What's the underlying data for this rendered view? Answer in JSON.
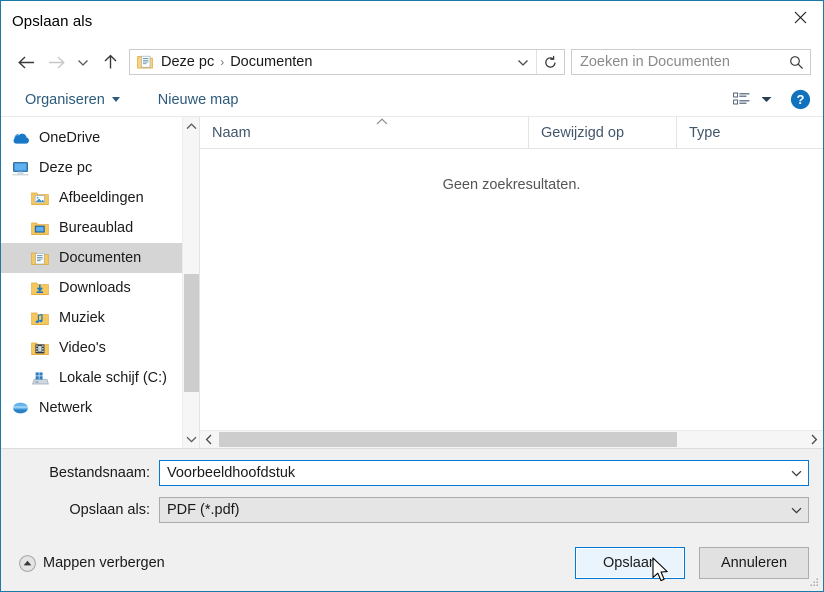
{
  "window": {
    "title": "Opslaan als",
    "close_icon": "close-icon"
  },
  "navigation": {
    "back_label": "Terug",
    "forward_label": "Vooruit",
    "recent_label": "Recente locaties",
    "up_label": "Omhoog",
    "breadcrumbs": [
      "Deze pc",
      "Documenten"
    ],
    "separator": "›",
    "refresh_label": "Vernieuwen"
  },
  "search": {
    "placeholder": "Zoeken in Documenten"
  },
  "toolbar": {
    "organize_label": "Organiseren",
    "new_folder_label": "Nieuwe map",
    "view_label": "De weergave wijzigen",
    "help_label": "Help",
    "help_glyph": "?"
  },
  "sidebar": {
    "items": [
      {
        "label": "OneDrive",
        "icon": "onedrive-cloud-icon",
        "indent": false,
        "selected": false
      },
      {
        "label": "Deze pc",
        "icon": "this-pc-icon",
        "indent": false,
        "selected": false
      },
      {
        "label": "Afbeeldingen",
        "icon": "pictures-folder-icon",
        "indent": true,
        "selected": false
      },
      {
        "label": "Bureaublad",
        "icon": "desktop-folder-icon",
        "indent": true,
        "selected": false
      },
      {
        "label": "Documenten",
        "icon": "documents-folder-icon",
        "indent": true,
        "selected": true
      },
      {
        "label": "Downloads",
        "icon": "downloads-folder-icon",
        "indent": true,
        "selected": false
      },
      {
        "label": "Muziek",
        "icon": "music-folder-icon",
        "indent": true,
        "selected": false
      },
      {
        "label": "Video's",
        "icon": "videos-folder-icon",
        "indent": true,
        "selected": false
      },
      {
        "label": "Lokale schijf (C:)",
        "icon": "local-disk-icon",
        "indent": true,
        "selected": false
      },
      {
        "label": "Netwerk",
        "icon": "network-icon",
        "indent": false,
        "selected": false
      }
    ]
  },
  "filelist": {
    "columns": [
      "Naam",
      "Gewijzigd op",
      "Type"
    ],
    "sorted_column": "Naam",
    "sort_direction": "ascending",
    "empty_message": "Geen zoekresultaten.",
    "rows": []
  },
  "form": {
    "filename_label": "Bestandsnaam:",
    "filename_value": "Voorbeeldhoofdstuk",
    "filetype_label": "Opslaan als:",
    "filetype_value": "PDF (*.pdf)"
  },
  "footer": {
    "hide_folders_label": "Mappen verbergen",
    "save_label": "Opslaan",
    "cancel_label": "Annuleren"
  },
  "colors": {
    "accent": "#0078d7",
    "window_border": "#1d7aa8",
    "dialog_bg": "#f0f0f0",
    "command_link": "#2d5a7b",
    "selection": "#d5d5d5"
  }
}
